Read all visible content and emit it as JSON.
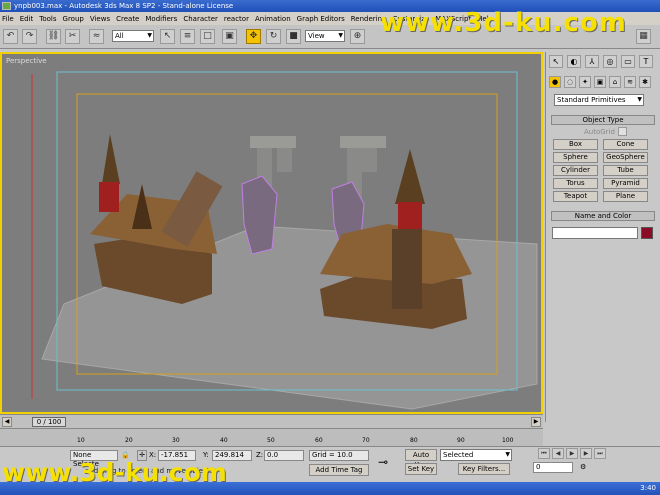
{
  "window": {
    "title": "ynpb003.max - Autodesk 3ds Max 8 SP2 - Stand-alone License"
  },
  "menu": [
    "File",
    "Edit",
    "Tools",
    "Group",
    "Views",
    "Create",
    "Modifiers",
    "Character",
    "reactor",
    "Animation",
    "Graph Editors",
    "Rendering",
    "Customize",
    "MAXScript",
    "Help"
  ],
  "toolbar": {
    "selection_filter": "All",
    "ref_coord": "View"
  },
  "watermark": "www.3d-ku.com",
  "viewport": {
    "label": "Perspective"
  },
  "command_panel": {
    "category": "Standard Primitives",
    "object_type_title": "Object Type",
    "autogrid": "AutoGrid",
    "buttons": [
      "Box",
      "Cone",
      "Sphere",
      "GeoSphere",
      "Cylinder",
      "Tube",
      "Torus",
      "Pyramid",
      "Teapot",
      "Plane"
    ],
    "name_color_title": "Name and Color",
    "color": "#8a0a28"
  },
  "timeline": {
    "frame": "0 / 100",
    "ticks": [
      "10",
      "20",
      "30",
      "40",
      "50",
      "60",
      "70",
      "80",
      "90",
      "100"
    ]
  },
  "status": {
    "selection": "None Selecte",
    "x_label": "X:",
    "x": "-17.851",
    "y_label": "Y:",
    "y": "249.814",
    "z_label": "Z:",
    "z": "0.0",
    "grid": "Grid = 10.0",
    "add_time_tag": "Add Time Tag",
    "auto_key": "Auto Key",
    "set_key": "Set Key",
    "key_mode": "Selected",
    "key_filters": "Key Filters...",
    "frame_field": "0",
    "prompt": "and drag to select and move objects"
  },
  "taskbar": {
    "time": "3:40"
  }
}
